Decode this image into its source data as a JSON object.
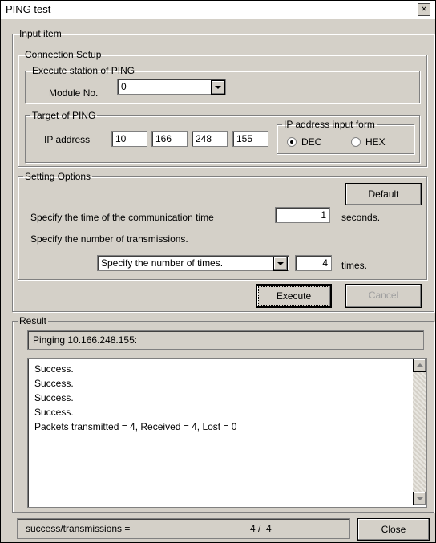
{
  "window": {
    "title": "PING test",
    "close_label": "×"
  },
  "input_item": {
    "legend": "Input item",
    "connection_setup": {
      "legend": "Connection Setup",
      "execute_station": {
        "legend": "Execute station of PING",
        "module_label": "Module No.",
        "module_value": "0"
      },
      "target": {
        "legend": "Target of PING",
        "ip_label": "IP address",
        "ip_octets": [
          "10",
          "166",
          "248",
          "155"
        ],
        "input_form": {
          "legend": "IP address input form",
          "dec_label": "DEC",
          "hex_label": "HEX",
          "selected": "DEC"
        }
      }
    },
    "setting_options": {
      "legend": "Setting Options",
      "default_label": "Default",
      "comm_time_label": "Specify the time of the communication time",
      "comm_time_value": "1",
      "comm_time_unit": "seconds.",
      "transmissions_label": "Specify the number of transmissions.",
      "transmissions_mode": "Specify the number of times.",
      "transmissions_value": "4",
      "transmissions_unit": "times."
    },
    "execute_label": "Execute",
    "cancel_label": "Cancel"
  },
  "result": {
    "legend": "Result",
    "status_line": "Pinging 10.166.248.155:",
    "lines": [
      "Success.",
      "Success.",
      "Success.",
      "Success.",
      "Packets transmitted = 4, Received = 4, Lost = 0"
    ]
  },
  "footer": {
    "summary_label": "success/transmissions =",
    "summary_value": "4 /  4",
    "close_label": "Close"
  }
}
